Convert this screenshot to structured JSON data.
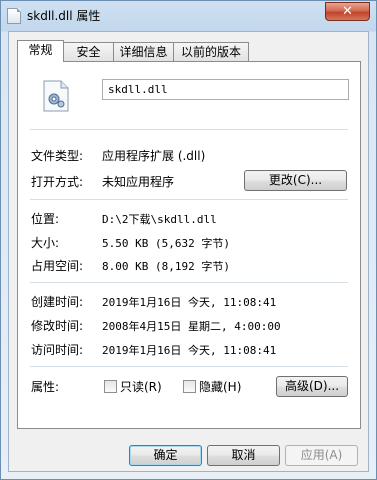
{
  "window": {
    "title": "skdll.dll 属性",
    "close_label": "✕"
  },
  "tabs": [
    {
      "label": "常规",
      "active": true
    },
    {
      "label": "安全",
      "active": false
    },
    {
      "label": "详细信息",
      "active": false
    },
    {
      "label": "以前的版本",
      "active": false
    }
  ],
  "general": {
    "file_name": "skdll.dll",
    "file_type": {
      "label": "文件类型:",
      "value": "应用程序扩展 (.dll)"
    },
    "opens_with": {
      "label": "打开方式:",
      "value": "未知应用程序",
      "change_button": "更改(C)..."
    },
    "location": {
      "label": "位置:",
      "value": "D:\\2下载\\skdll.dll"
    },
    "size": {
      "label": "大小:",
      "value": "5.50 KB (5,632 字节)"
    },
    "size_on_disk": {
      "label": "占用空间:",
      "value": "8.00 KB (8,192 字节)"
    },
    "created": {
      "label": "创建时间:",
      "value": "2019年1月16日 今天, 11:08:41"
    },
    "modified": {
      "label": "修改时间:",
      "value": "2008年4月15日 星期二, 4:00:00"
    },
    "accessed": {
      "label": "访问时间:",
      "value": "2019年1月16日 今天, 11:08:41"
    },
    "attributes": {
      "label": "属性:",
      "readonly": "只读(R)",
      "hidden": "隐藏(H)",
      "advanced_button": "高级(D)..."
    }
  },
  "buttons": {
    "ok": "确定",
    "cancel": "取消",
    "apply": "应用(A)"
  }
}
